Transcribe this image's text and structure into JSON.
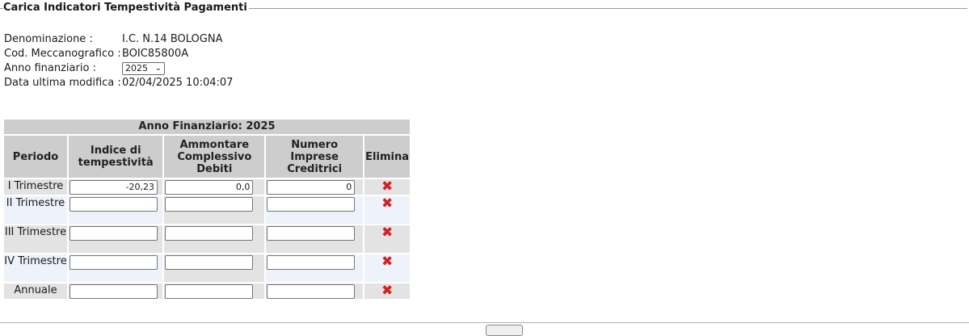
{
  "title": "Carica Indicatori Tempestività Pagamenti",
  "info": {
    "denominazione_label": "Denominazione :",
    "denominazione_value": "I.C. N.14 BOLOGNA",
    "codice_label": "Cod. Meccanografico :",
    "codice_value": "BOIC85800A",
    "anno_label": "Anno finanziario :",
    "anno_value": "2025",
    "data_label": "Data ultima modifica :",
    "data_value": "02/04/2025 10:04:07"
  },
  "table": {
    "caption": "Anno Finanziario: 2025",
    "headers": {
      "periodo": "Periodo",
      "indice": "Indice di tempestività",
      "ammontare": "Ammontare Complessivo Debiti",
      "numero": "Numero Imprese Creditrici",
      "elimina": "Elimina"
    },
    "rows": [
      {
        "periodo": "I Trimestre",
        "indice": "-20,23",
        "ammontare": "0,0",
        "numero": "0"
      },
      {
        "periodo": "II Trimestre",
        "indice": "",
        "ammontare": "",
        "numero": ""
      },
      {
        "periodo": "III Trimestre",
        "indice": "",
        "ammontare": "",
        "numero": ""
      },
      {
        "periodo": "IV Trimestre",
        "indice": "",
        "ammontare": "",
        "numero": ""
      },
      {
        "periodo": "Annuale",
        "indice": "",
        "ammontare": "",
        "numero": ""
      }
    ]
  },
  "icons": {
    "delete": "delete-x-icon",
    "dropdown": "chevron-down-icon"
  },
  "colors": {
    "delete_icon": "#d42020",
    "header_bg": "#cdcdcd",
    "row_alt_bg": "#edf2fb"
  }
}
